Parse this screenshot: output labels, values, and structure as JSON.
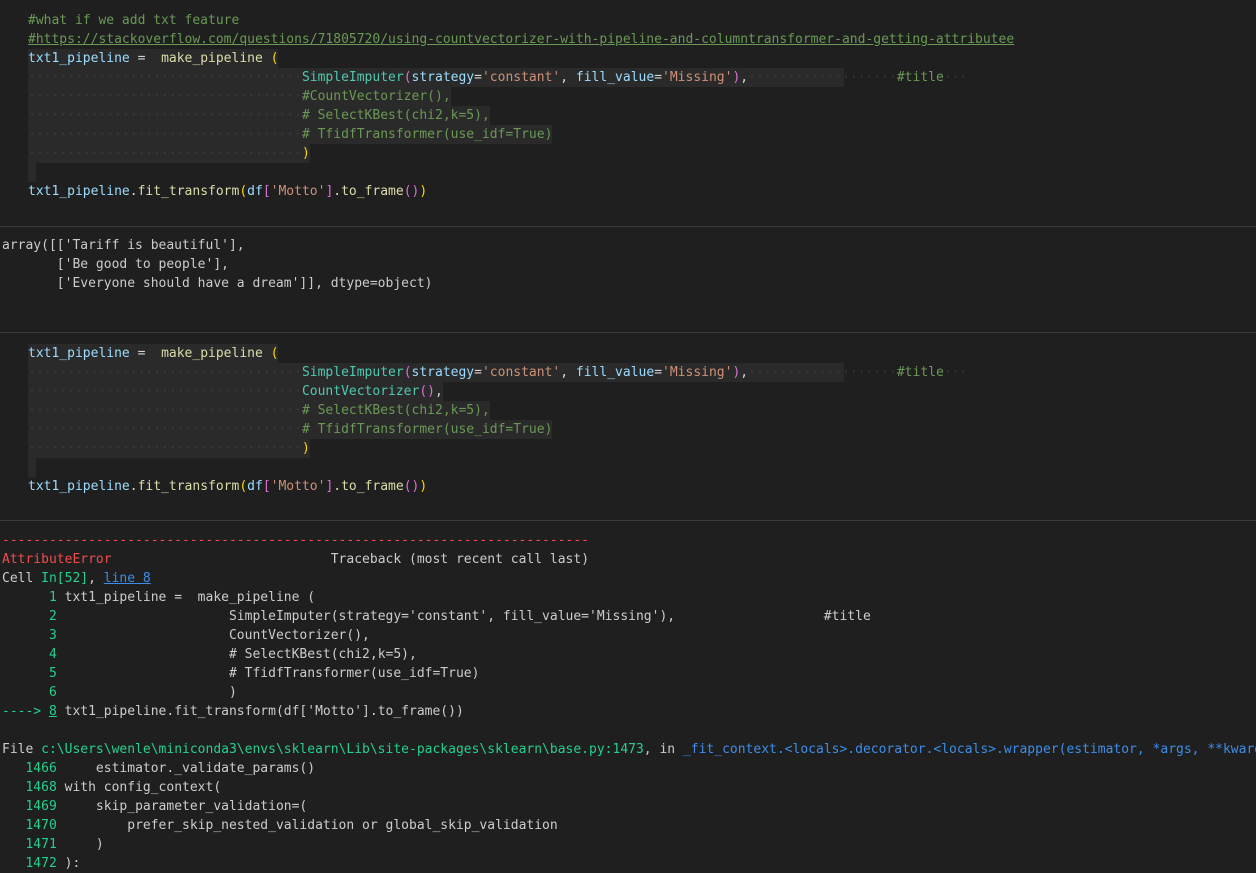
{
  "cell1": {
    "comment1": "#what if we add txt feature",
    "comment2": "#https://stackoverflow.com/questions/71805720/using-countvectorizer-with-pipeline-and-columntransformer-and-getting-attributee",
    "var": "txt1_pipeline",
    "eq": " =  ",
    "func": "make_pipeline",
    "paren_open": " (",
    "imputer_cls": "SimpleImputer",
    "imputer_args_a": "strategy",
    "imputer_val_a": "'constant'",
    "imputer_args_b": "fill_value",
    "imputer_val_b": "'Missing'",
    "title_comment": "#title",
    "cv_line": "#CountVectorizer(),",
    "skb_line": "# SelectKBest(chi2,k=5),",
    "tfidf_line": "# TfidfTransformer(use_idf=True)",
    "close_paren": ")",
    "fit_call_var": "txt1_pipeline",
    "fit_call_method": ".fit_transform",
    "fit_df": "df",
    "fit_col": "'Motto'",
    "fit_to_frame": ".to_frame"
  },
  "output1": {
    "line1": "array([['Tariff is beautiful'],",
    "line2": "       ['Be good to people'],",
    "line3": "       ['Everyone should have a dream']], dtype=object)"
  },
  "cell2": {
    "var": "txt1_pipeline",
    "func": "make_pipeline",
    "imputer_cls": "SimpleImputer",
    "imputer_args_a": "strategy",
    "imputer_val_a": "'constant'",
    "imputer_args_b": "fill_value",
    "imputer_val_b": "'Missing'",
    "title_comment": "#title",
    "cv_cls": "CountVectorizer",
    "skb_line": "# SelectKBest(chi2,k=5),",
    "tfidf_line": "# TfidfTransformer(use_idf=True)",
    "close_paren": ")",
    "fit_call_var": "txt1_pipeline",
    "fit_call_method": ".fit_transform",
    "fit_df": "df",
    "fit_col": "'Motto'",
    "fit_to_frame": ".to_frame"
  },
  "error": {
    "dashes": "---------------------------------------------------------------------------",
    "name": "AttributeError",
    "traceback_label": "Traceback (most recent call last)",
    "cell_prefix": "Cell ",
    "cell_in": "In[52]",
    "cell_sep": ", ",
    "cell_line_link": "line 8",
    "src_lines": [
      {
        "num": "1",
        "text": "txt1_pipeline =  make_pipeline ("
      },
      {
        "num": "2",
        "text": "                     SimpleImputer(strategy='constant', fill_value='Missing'),                   #title"
      },
      {
        "num": "3",
        "text": "                     CountVectorizer(),"
      },
      {
        "num": "4",
        "text": "                     # SelectKBest(chi2,k=5),"
      },
      {
        "num": "5",
        "text": "                     # TfidfTransformer(use_idf=True)"
      },
      {
        "num": "6",
        "text": "                     )"
      }
    ],
    "arrow": "----> ",
    "arrow_num": "8",
    "arrow_text": " txt1_pipeline.fit_transform(df['Motto'].to_frame())",
    "file_prefix": "File ",
    "file_path": "c:\\Users\\wenle\\miniconda3\\envs\\sklearn\\Lib\\site-packages\\sklearn\\base.py:1473",
    "file_in": ", in ",
    "file_func": "_fit_context.<locals>.decorator.<locals>.wrapper(estimator, *args, **kwargs)",
    "frame_lines": [
      {
        "num": "1466",
        "text": "     estimator._validate_params()"
      },
      {
        "num": "1468",
        "text": " with config_context("
      },
      {
        "num": "1469",
        "text": "     skip_parameter_validation=("
      },
      {
        "num": "1470",
        "text": "         prefer_skip_nested_validation or global_skip_validation"
      },
      {
        "num": "1471",
        "text": "     )"
      },
      {
        "num": "1472",
        "text": " ):"
      }
    ]
  }
}
